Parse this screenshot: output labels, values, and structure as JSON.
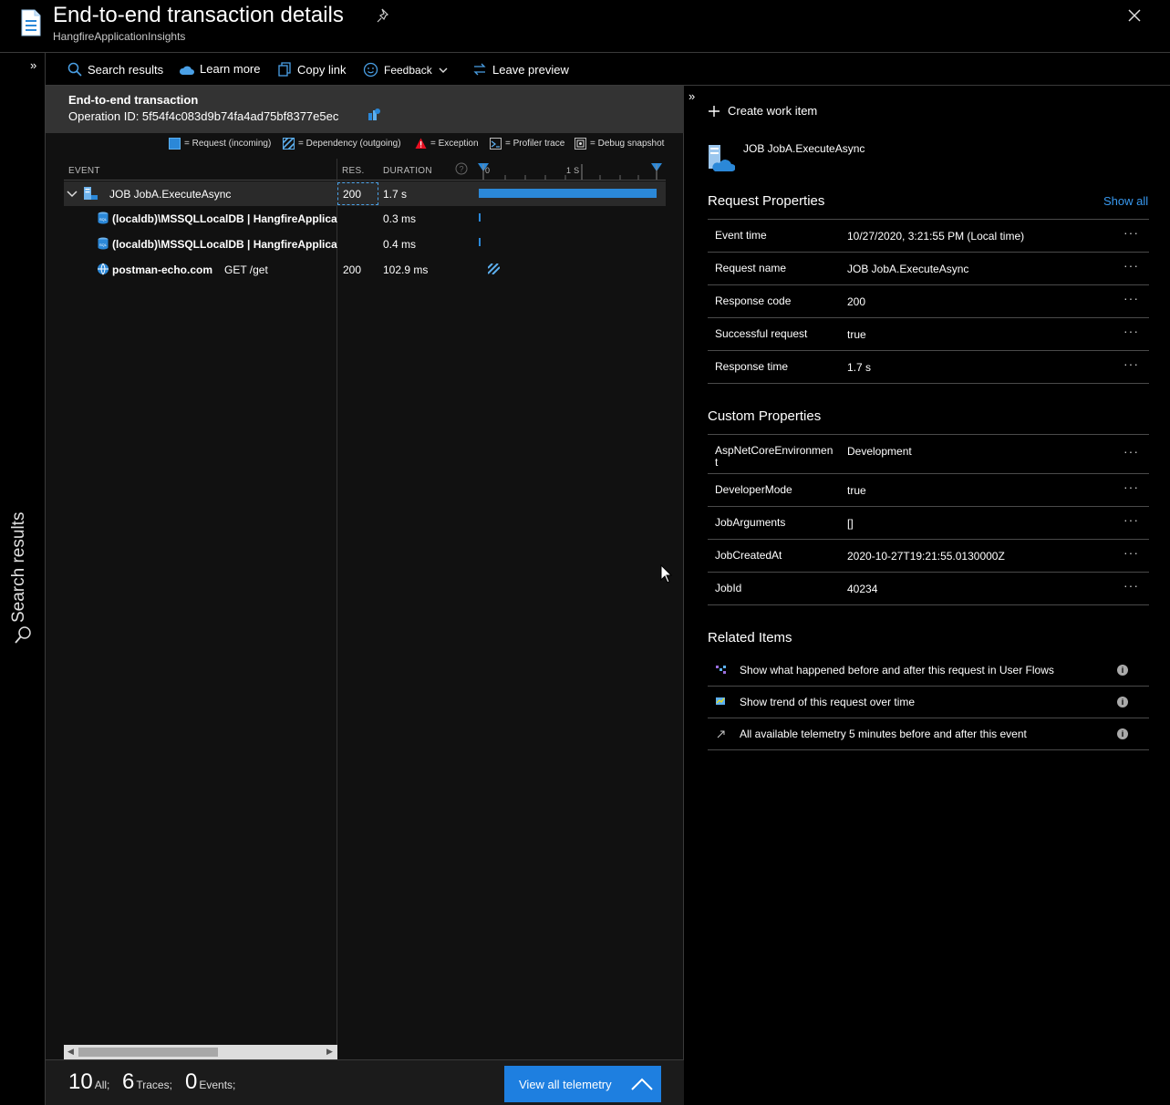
{
  "header": {
    "title": "End-to-end transaction details",
    "subtitle": "HangfireApplicationInsights"
  },
  "rail": {
    "label": "Search results"
  },
  "toolbar": {
    "search_results": "Search results",
    "learn_more": "Learn more",
    "copy_link": "Copy link",
    "feedback": "Feedback",
    "leave_preview": "Leave preview"
  },
  "transaction": {
    "title": "End-to-end transaction",
    "operation_id": "Operation ID: 5f54f4c083d9b74fa4ad75bf8377e5ec"
  },
  "legend": {
    "request": "= Request (incoming)",
    "dependency": "= Dependency (outgoing)",
    "exception": "= Exception",
    "profiler": "= Profiler trace",
    "snapshot": "= Debug snapshot"
  },
  "columns": {
    "event": "EVENT",
    "res": "RES.",
    "duration": "DURATION",
    "tick0": "0",
    "tick1": "1 S"
  },
  "rows": [
    {
      "event": "JOB JobA.ExecuteAsync",
      "res": "200",
      "duration": "1.7 s"
    },
    {
      "event": "(localdb)\\MSSQLLocalDB | HangfireApplicationInsights",
      "res": "",
      "duration": "0.3 ms"
    },
    {
      "event": "(localdb)\\MSSQLLocalDB | HangfireApplicationInsights",
      "res": "",
      "duration": "0.4 ms"
    },
    {
      "event": "postman-echo.com",
      "detail": "GET /get",
      "res": "200",
      "duration": "102.9 ms"
    }
  ],
  "footer": {
    "all_num": "10",
    "all_lbl": "All;",
    "traces_num": "6",
    "traces_lbl": "Traces;",
    "events_num": "0",
    "events_lbl": "Events;",
    "view_all": "View all telemetry"
  },
  "right": {
    "create_work_item": "Create work item",
    "request_name": "JOB JobA.ExecuteAsync",
    "request_props_title": "Request Properties",
    "show_all": "Show all",
    "request_props": [
      {
        "k": "Event time",
        "v": "10/27/2020, 3:21:55 PM (Local time)"
      },
      {
        "k": "Request name",
        "v": "JOB JobA.ExecuteAsync"
      },
      {
        "k": "Response code",
        "v": "200"
      },
      {
        "k": "Successful request",
        "v": "true"
      },
      {
        "k": "Response time",
        "v": "1.7 s"
      }
    ],
    "custom_props_title": "Custom Properties",
    "custom_props": [
      {
        "k": "AspNetCoreEnvironment",
        "v": "Development"
      },
      {
        "k": "DeveloperMode",
        "v": "true"
      },
      {
        "k": "JobArguments",
        "v": "[]"
      },
      {
        "k": "JobCreatedAt",
        "v": "2020-10-27T19:21:55.0130000Z"
      },
      {
        "k": "JobId",
        "v": "40234"
      }
    ],
    "related_title": "Related Items",
    "related": [
      {
        "t": "Show what happened before and after this request in User Flows"
      },
      {
        "t": "Show trend of this request over time"
      },
      {
        "t": "All available telemetry 5 minutes before and after this event"
      }
    ],
    "more": "···",
    "info": "i"
  },
  "colors": {
    "accent": "#1e7fe0",
    "link": "#3899f0",
    "bar": "#2b88d8"
  }
}
